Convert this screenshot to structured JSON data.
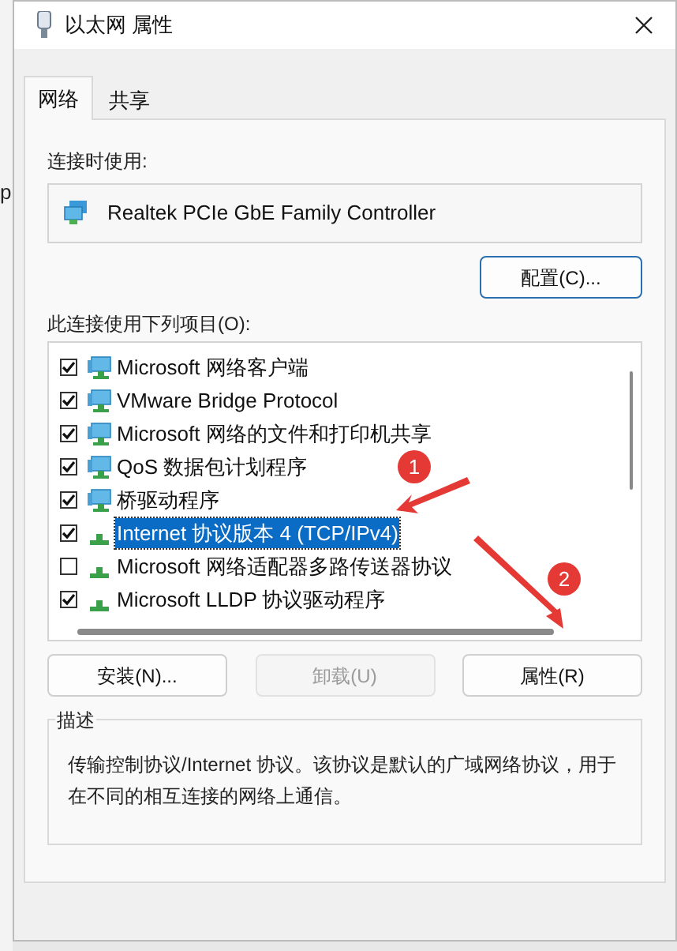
{
  "background_window": {
    "fragment": "p"
  },
  "window": {
    "title": "以太网 属性"
  },
  "tabs": [
    {
      "label": "网络",
      "selected": true
    },
    {
      "label": "共享",
      "selected": false
    }
  ],
  "connect_using": {
    "label": "连接时使用:",
    "adapter": "Realtek PCIe GbE Family Controller",
    "configure_button": "配置(C)..."
  },
  "items_list": {
    "label": "此连接使用下列项目(O):",
    "items": [
      {
        "label": "Microsoft 网络客户端",
        "checked": true,
        "selected": false,
        "kind": "monitor"
      },
      {
        "label": "VMware Bridge Protocol",
        "checked": true,
        "selected": false,
        "kind": "monitor"
      },
      {
        "label": "Microsoft 网络的文件和打印机共享",
        "checked": true,
        "selected": false,
        "kind": "monitor"
      },
      {
        "label": "QoS 数据包计划程序",
        "checked": true,
        "selected": false,
        "kind": "monitor"
      },
      {
        "label": "桥驱动程序",
        "checked": true,
        "selected": false,
        "kind": "monitor"
      },
      {
        "label": "Internet 协议版本 4 (TCP/IPv4)",
        "checked": true,
        "selected": true,
        "kind": "protocol"
      },
      {
        "label": "Microsoft 网络适配器多路传送器协议",
        "checked": false,
        "selected": false,
        "kind": "protocol"
      },
      {
        "label": "Microsoft LLDP 协议驱动程序",
        "checked": true,
        "selected": false,
        "kind": "protocol"
      }
    ]
  },
  "buttons": [
    {
      "label": "安装(N)...",
      "disabled": false
    },
    {
      "label": "卸载(U)",
      "disabled": true
    },
    {
      "label": "属性(R)",
      "disabled": false
    }
  ],
  "description": {
    "label": "描述",
    "text": "传输控制协议/Internet 协议。该协议是默认的广域网络协议，用于在不同的相互连接的网络上通信。"
  },
  "annotations": [
    {
      "number": "1"
    },
    {
      "number": "2"
    }
  ]
}
